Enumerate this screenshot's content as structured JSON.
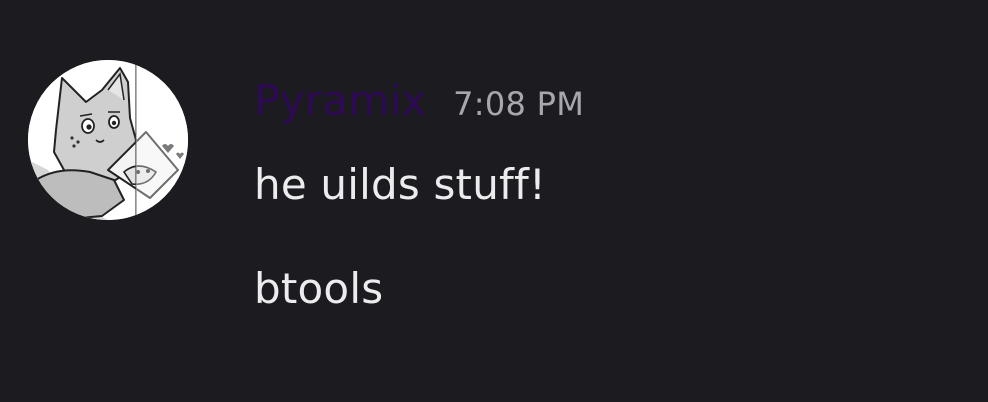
{
  "message": {
    "author": {
      "username": "Pyramix",
      "username_color": "#2e0a55",
      "avatar": "cat-character-sketch-avatar"
    },
    "timestamp": "7:08 PM",
    "lines": [
      "he uilds stuff!",
      "btools"
    ]
  },
  "theme": {
    "background": "#1c1b20",
    "text": "#ececef",
    "muted_text": "#a7a7ae"
  }
}
